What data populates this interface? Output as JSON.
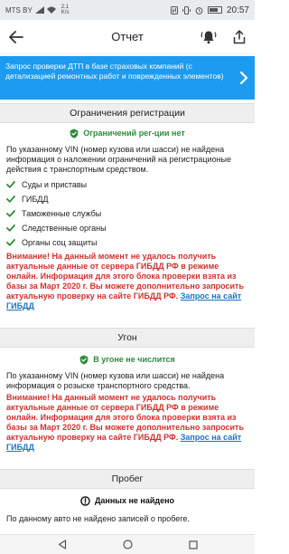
{
  "status_bar": {
    "carrier": "MTS BY",
    "speed_value": "2.1",
    "speed_unit": "K/s",
    "time": "20:57",
    "icons": [
      "signal-icon",
      "wifi-icon",
      "nfc-icon",
      "vibrate-icon",
      "alarm-icon",
      "battery-icon"
    ]
  },
  "app_bar": {
    "title": "Отчет",
    "icons": [
      "back-arrow-icon",
      "bell-alert-icon",
      "share-icon"
    ]
  },
  "banner": {
    "text": "Запрос проверки ДТП в базе страховых компаний (с детализацией ремонтных работ и поврежденных элементов)",
    "color": "#1d9bf0"
  },
  "restrictions": {
    "header": "Ограничения регистрации",
    "status": "Ограничений рег-ции нет",
    "description": "По указанному VIN (номер кузова или шасси) не найдена информация о наложении ограничений на регистрационые действия с транспортным средством.",
    "checks": [
      "Суды и приставы",
      "ГИБДД",
      "Таможенные службы",
      "Следственные органы",
      "Органы соц защиты"
    ],
    "warning": "Внимание! На данный момент не удалось получить актуальные данные от сервера ГИБДД РФ в режиме онлайн. Информация для этого блока проверки взята из базы за Март 2020 г. Вы можете дополнительно запросить актуальную проверку на сайте ГИБДД РФ.",
    "link": "Запрос на сайт ГИБДД"
  },
  "theft": {
    "header": "Угон",
    "status": "В угоне не числится",
    "description": "По указанному VIN (номер кузова или шасси) не найдена информация о розыске транспортного средства.",
    "warning": "Внимание! На данный момент не удалось получить актуальные данные от сервера ГИБДД РФ в режиме онлайн. Информация для этого блока проверки взята из базы за Март 2020 г. Вы можете дополнительно запросить актуальную проверку на сайте ГИБДД РФ.",
    "link": "Запрос на сайт ГИБДД"
  },
  "mileage": {
    "header": "Пробег",
    "status": "Данных не найдено",
    "description": "По данному авто не найдено записей о пробеге."
  },
  "colors": {
    "ok_green": "#2e8b3a",
    "warning_red": "#d32f2f",
    "link_blue": "#1a73c8"
  }
}
